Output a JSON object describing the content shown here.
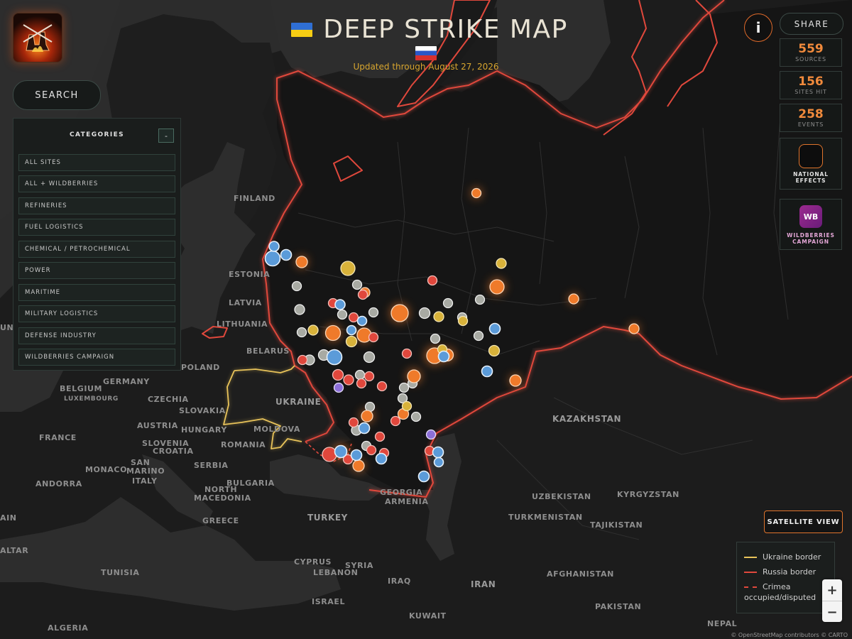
{
  "header": {
    "title": "DEEP STRIKE MAP",
    "updated": "Updated through August 27, 2026"
  },
  "search": {
    "label": "SEARCH"
  },
  "categories": {
    "title": "CATEGORIES",
    "collapse_label": "-",
    "items": [
      "ALL SITES",
      "ALL + WILDBERRIES",
      "REFINERIES",
      "FUEL LOGISTICS",
      "CHEMICAL / PETROCHEMICAL",
      "POWER",
      "MARITIME",
      "MILITARY LOGISTICS",
      "DEFENSE INDUSTRY",
      "WILDBERRIES CAMPAIGN"
    ]
  },
  "toolbar": {
    "info_label": "i",
    "share_label": "SHARE"
  },
  "stats": [
    {
      "value": "559",
      "label": "SOURCES"
    },
    {
      "value": "156",
      "label": "SITES HIT"
    },
    {
      "value": "258",
      "label": "EVENTS"
    }
  ],
  "features": {
    "national_effects": {
      "line1": "NATIONAL",
      "line2": "EFFECTS"
    },
    "wildberries": {
      "icon_text": "WB",
      "line1": "WILDBERRIES",
      "line2": "CAMPAIGN"
    }
  },
  "satellite": {
    "label": "SATELLITE VIEW"
  },
  "legend": {
    "ukraine": "Ukraine border",
    "russia": "Russia border",
    "crimea_1": "Crimea",
    "crimea_2": "occupied/disputed"
  },
  "zoom": {
    "in": "+",
    "out": "−"
  },
  "attribution": "© OpenStreetMap contributors © CARTO",
  "map_labels": {
    "finland": "FINLAND",
    "estonia": "ESTONIA",
    "latvia": "LATVIA",
    "lithuania": "LITHUANIA",
    "belarus": "BELARUS",
    "poland": "POLAND",
    "germany": "GERMANY",
    "belgium": "BELGIUM",
    "luxembourg": "LUXEMBOURG",
    "czechia": "CZECHIA",
    "slovakia": "SLOVAKIA",
    "austria": "AUSTRIA",
    "hungary": "HUNGARY",
    "moldova": "MOLDOVA",
    "ukraine": "UKRAINE",
    "romania": "ROMANIA",
    "slovenia": "SLOVENIA",
    "croatia": "CROATIA",
    "france": "FRANCE",
    "monaco": "MONACO",
    "san_marino_1": "SAN",
    "san_marino_2": "MARINO",
    "serbia": "SERBIA",
    "andorra": "ANDORRA",
    "italy": "ITALY",
    "bulgaria": "BULGARIA",
    "north_macedonia_1": "NORTH",
    "north_macedonia_2": "MACEDONIA",
    "greece": "GREECE",
    "turkey": "TURKEY",
    "georgia": "GEORGIA",
    "armenia": "ARMENIA",
    "kazakhstan": "KAZAKHSTAN",
    "uzbekistan": "UZBEKISTAN",
    "kyrgyzstan": "KYRGYZSTAN",
    "turkmenistan": "TURKMENISTAN",
    "tajikistan": "TAJIKISTAN",
    "afghanistan": "AFGHANISTAN",
    "pakistan": "PAKISTAN",
    "nepal": "NEPAL",
    "iran": "IRAN",
    "iraq": "IRAQ",
    "syria": "SYRIA",
    "cyprus": "CYPRUS",
    "lebanon": "LEBANON",
    "israel": "ISRAEL",
    "kuwait": "KUWAIT",
    "tunisia": "TUNISIA",
    "algeria": "ALGERIA",
    "malta": "ALTAR",
    "spain_partial": "AIN",
    "denmark_partial": "UN"
  },
  "colors": {
    "background": "#2a2a2a",
    "land": "#1c1c1c",
    "russia_land": "#151515",
    "water": "#2b2b2b",
    "ukraine_border": "#e8c35a",
    "russia_border": "#e0483c",
    "accent": "#f08a3c",
    "marker_orange": "#ef7a2a",
    "marker_red": "#e0473c",
    "marker_blue": "#5b9bd9",
    "marker_gray": "#a8aaa3",
    "marker_yellow": "#d8b23a",
    "marker_purple": "#8c6fd8"
  },
  "icons": {
    "logo": "burning-refinery-logo-icon",
    "info": "info-icon",
    "national_effects": "national-effects-icon",
    "wildberries": "wildberries-icon"
  }
}
